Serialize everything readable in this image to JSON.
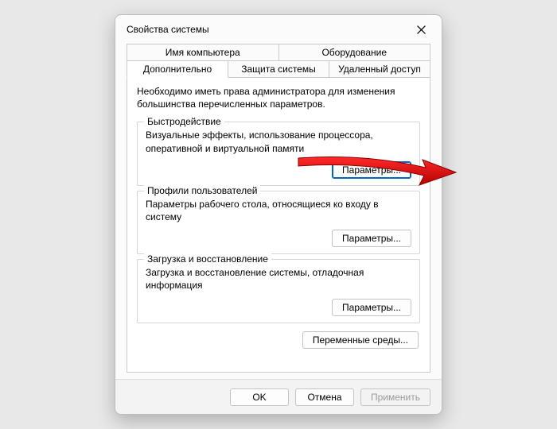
{
  "window": {
    "title": "Свойства системы"
  },
  "tabs": {
    "row1": [
      "Имя компьютера",
      "Оборудование"
    ],
    "row2": [
      "Дополнительно",
      "Защита системы",
      "Удаленный доступ"
    ],
    "active": "Дополнительно"
  },
  "admin_note": "Необходимо иметь права администратора для изменения большинства перечисленных параметров.",
  "groups": {
    "performance": {
      "title": "Быстродействие",
      "desc": "Визуальные эффекты, использование процессора, оперативной и виртуальной памяти",
      "button": "Параметры..."
    },
    "profiles": {
      "title": "Профили пользователей",
      "desc": "Параметры рабочего стола, относящиеся ко входу в систему",
      "button": "Параметры..."
    },
    "startup": {
      "title": "Загрузка и восстановление",
      "desc": "Загрузка и восстановление системы, отладочная информация",
      "button": "Параметры..."
    }
  },
  "env_button": "Переменные среды...",
  "footer": {
    "ok": "OK",
    "cancel": "Отмена",
    "apply": "Применить"
  }
}
